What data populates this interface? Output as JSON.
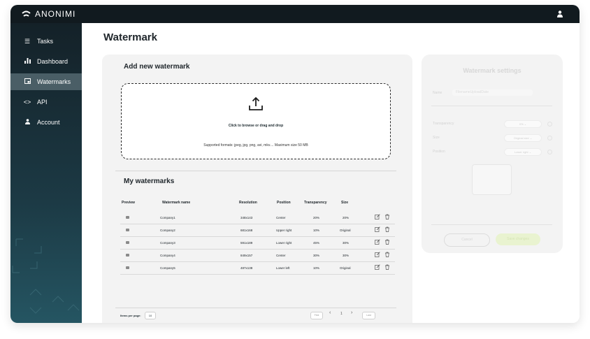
{
  "app": {
    "brand": "ANONIMI"
  },
  "sidebar": {
    "items": [
      {
        "label": "Tasks",
        "icon": "list-icon"
      },
      {
        "label": "Dashboard",
        "icon": "bar-chart-icon"
      },
      {
        "label": "Watermarks",
        "icon": "watermark-icon",
        "active": true
      },
      {
        "label": "API",
        "icon": "code-icon"
      },
      {
        "label": "Account",
        "icon": "user-icon"
      }
    ]
  },
  "page": {
    "title": "Watermark"
  },
  "upload": {
    "heading": "Add new watermark",
    "cta": "Click to browse or drag and drop",
    "formats": "Supported formats: jpeg, jpg, png, avi, mkv.... Maximum size 50 MB"
  },
  "watermarks": {
    "heading": "My watermarks",
    "columns": [
      "Preview",
      "Watermark name",
      "Resolution",
      "Position",
      "Transparency",
      "Size"
    ],
    "rows": [
      {
        "name": "Company1",
        "resolution": "348x143",
        "position": "Center",
        "transparency": "20%",
        "size": "20%"
      },
      {
        "name": "Company2",
        "resolution": "681x168",
        "position": "Upper right",
        "transparency": "10%",
        "size": "Original"
      },
      {
        "name": "Company3",
        "resolution": "591x189",
        "position": "Lower right",
        "transparency": "45%",
        "size": "30%"
      },
      {
        "name": "Company4",
        "resolution": "849x157",
        "position": "Center",
        "transparency": "30%",
        "size": "30%"
      },
      {
        "name": "Company5",
        "resolution": "487x138",
        "position": "Lower left",
        "transparency": "10%",
        "size": "Original"
      }
    ]
  },
  "pagination": {
    "items_per_page_label": "Items per page:",
    "items_per_page": "10",
    "first": "First",
    "page": "1",
    "last": "Last"
  },
  "settings": {
    "title": "Watermark settings",
    "name_label": "Name",
    "name_placeholder": "FilenameUploadDate",
    "transparency_label": "Transparency",
    "transparency_value": "0%",
    "size_label": "Size",
    "size_value": "Original size",
    "position_label": "Position",
    "position_value": "Lower right",
    "cancel": "Cancel",
    "save": "Save changes"
  },
  "colors": {
    "sidebar_active": "#4a5e66",
    "topbar": "#111a1f",
    "save_button": "#e9f3d0"
  }
}
